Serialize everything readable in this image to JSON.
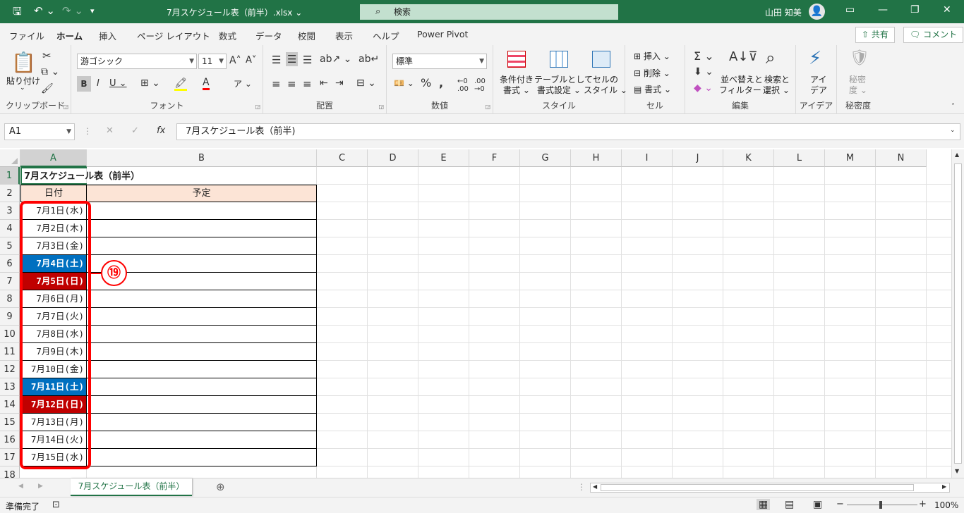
{
  "titlebar": {
    "doc_title": "7月スケジュール表（前半）.xlsx ⌄",
    "search_placeholder": "検索",
    "user_name": "山田 知美"
  },
  "tabs": [
    {
      "label": "ファイル"
    },
    {
      "label": "ホーム"
    },
    {
      "label": "挿入"
    },
    {
      "label": "ページ レイアウト"
    },
    {
      "label": "数式"
    },
    {
      "label": "データ"
    },
    {
      "label": "校閲"
    },
    {
      "label": "表示"
    },
    {
      "label": "ヘルプ"
    },
    {
      "label": "Power Pivot"
    }
  ],
  "share_label": "共有",
  "comment_label": "コメント",
  "ribbon": {
    "clipboard": {
      "label": "クリップボード",
      "paste": "貼り付け"
    },
    "font": {
      "label": "フォント",
      "name": "游ゴシック",
      "size": "11"
    },
    "alignment": {
      "label": "配置"
    },
    "number": {
      "label": "数値",
      "format": "標準"
    },
    "styles": {
      "label": "スタイル",
      "cond1": "条件付き",
      "cond2": "書式 ⌄",
      "table1": "テーブルとして",
      "table2": "書式設定 ⌄",
      "cell1": "セルの",
      "cell2": "スタイル ⌄"
    },
    "cells": {
      "label": "セル",
      "insert": "挿入",
      "delete": "削除",
      "format": "書式"
    },
    "editing": {
      "label": "編集",
      "sort1": "並べ替えと",
      "sort2": "フィルター ⌄",
      "find1": "検索と",
      "find2": "選択 ⌄"
    },
    "ideas": {
      "label": "アイデア",
      "l1": "アイ",
      "l2": "デア"
    },
    "sensitivity": {
      "label": "秘密度",
      "l1": "秘密",
      "l2": "度 ⌄"
    }
  },
  "formula_bar": {
    "name_box": "A1",
    "formula": "7月スケジュール表（前半)"
  },
  "columns": [
    "A",
    "B",
    "C",
    "D",
    "E",
    "F",
    "G",
    "H",
    "I",
    "J",
    "K",
    "L",
    "M",
    "N"
  ],
  "rows": [
    "1",
    "2",
    "3",
    "4",
    "5",
    "6",
    "7",
    "8",
    "9",
    "10",
    "11",
    "12",
    "13",
    "14",
    "15",
    "16",
    "17",
    "18"
  ],
  "sheet": {
    "title_cell": "7月スケジュール表（前半）",
    "header_date": "日付",
    "header_plan": "予定",
    "dates": [
      {
        "text": "7月1日(水)",
        "kind": "weekday"
      },
      {
        "text": "7月2日(木)",
        "kind": "weekday"
      },
      {
        "text": "7月3日(金)",
        "kind": "weekday"
      },
      {
        "text": "7月4日(土)",
        "kind": "saturday"
      },
      {
        "text": "7月5日(日)",
        "kind": "sunday"
      },
      {
        "text": "7月6日(月)",
        "kind": "weekday"
      },
      {
        "text": "7月7日(火)",
        "kind": "weekday"
      },
      {
        "text": "7月8日(水)",
        "kind": "weekday"
      },
      {
        "text": "7月9日(木)",
        "kind": "weekday"
      },
      {
        "text": "7月10日(金)",
        "kind": "weekday"
      },
      {
        "text": "7月11日(土)",
        "kind": "saturday"
      },
      {
        "text": "7月12日(日)",
        "kind": "sunday"
      },
      {
        "text": "7月13日(月)",
        "kind": "weekday"
      },
      {
        "text": "7月14日(火)",
        "kind": "weekday"
      },
      {
        "text": "7月15日(水)",
        "kind": "weekday"
      }
    ],
    "callout": "⑲"
  },
  "sheet_tab": "7月スケジュール表（前半）",
  "status": {
    "ready": "準備完了",
    "zoom": "100%"
  },
  "colors": {
    "accent": "#217346",
    "saturday": "#0070c0",
    "sunday": "#c00000",
    "highlight": "#ff0000",
    "header_fill": "#fce4d6"
  }
}
